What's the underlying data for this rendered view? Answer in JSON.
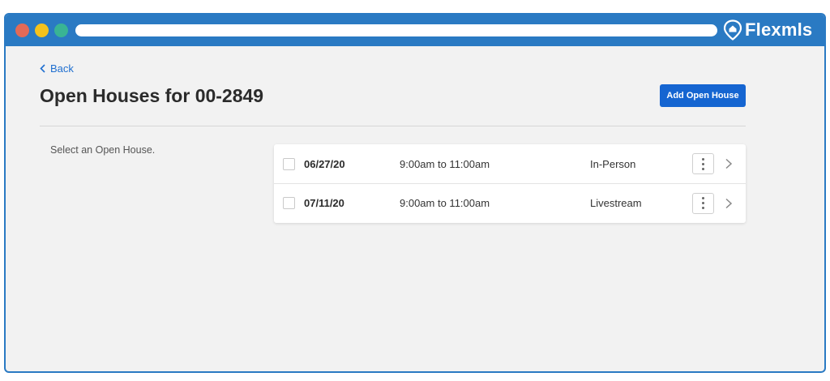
{
  "browser": {
    "brand_name": "Flexmls",
    "brand_color": "#2a7ac3",
    "window_buttons": [
      "close-dot",
      "minimize-dot",
      "maximize-dot"
    ]
  },
  "nav": {
    "back_label": "Back"
  },
  "header": {
    "title": "Open Houses for 00-2849",
    "add_button_label": "Add Open House",
    "accent_color": "#1565d1"
  },
  "hint": "Select an Open House.",
  "open_houses": [
    {
      "date": "06/27/20",
      "time": "9:00am to 11:00am",
      "type": "In-Person"
    },
    {
      "date": "07/11/20",
      "time": "9:00am to 11:00am",
      "type": "Livestream"
    }
  ],
  "icons": {
    "brand": "house-pin-icon",
    "back": "chevron-left-icon",
    "row_menu": "more-vertical-icon",
    "row_open": "chevron-right-icon"
  }
}
